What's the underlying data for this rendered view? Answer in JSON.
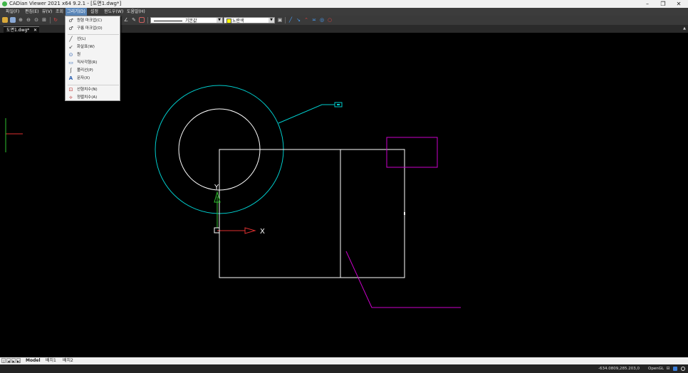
{
  "window": {
    "title": "CADian Viewer 2021 x64 9.2.1 - [도면1.dwg*]",
    "minimize": "–",
    "restore": "❐",
    "close": "✕"
  },
  "menu": {
    "items": [
      {
        "label": "파일(F)"
      },
      {
        "label": "편집(E)"
      },
      {
        "label": "뷰(V)"
      },
      {
        "label": "조회"
      },
      {
        "label": "그리기(D)"
      },
      {
        "label": "설정"
      },
      {
        "label": "윈도우(W)"
      },
      {
        "label": "도움말(H)"
      }
    ]
  },
  "toolbar": {
    "linetype_value": "기본값",
    "color_value": "노란색",
    "color_swatch": "#ffff00"
  },
  "document_tab": {
    "label": "도면1.dwg*",
    "close": "✕"
  },
  "draw_menu": {
    "items": [
      {
        "label": "원형 마크업(C)",
        "icon": "circle-markup-icon"
      },
      {
        "label": "구름 마크업(O)",
        "icon": "cloud-markup-icon"
      },
      {
        "label": "선(L)",
        "icon": "line-icon"
      },
      {
        "label": "화살표(W)",
        "icon": "arrow-icon"
      },
      {
        "label": "원",
        "icon": "circle-icon"
      },
      {
        "label": "직사각형(R)",
        "icon": "rectangle-icon"
      },
      {
        "label": "폴리선(P)",
        "icon": "polyline-icon"
      },
      {
        "label": "문자(X)",
        "icon": "text-icon"
      },
      {
        "label": "선형치수(N)",
        "icon": "linear-dimension-icon"
      },
      {
        "label": "정렬치수(A)",
        "icon": "aligned-dimension-icon"
      }
    ]
  },
  "canvas": {
    "ucs_x_label": "X",
    "ucs_y_label": "Y",
    "colors": {
      "background": "#000000",
      "white_entities": "#ffffff",
      "cyan_entities": "#00cccc",
      "magenta_entities": "#cc00cc",
      "axis_x": "#e03030",
      "axis_y": "#30c030"
    }
  },
  "layout_tabs": {
    "items": [
      {
        "label": "Model"
      },
      {
        "label": "배치1"
      },
      {
        "label": "배치2"
      }
    ]
  },
  "status": {
    "coordinates": "-634.0809,285.203,0",
    "renderer": "OpenGL"
  }
}
